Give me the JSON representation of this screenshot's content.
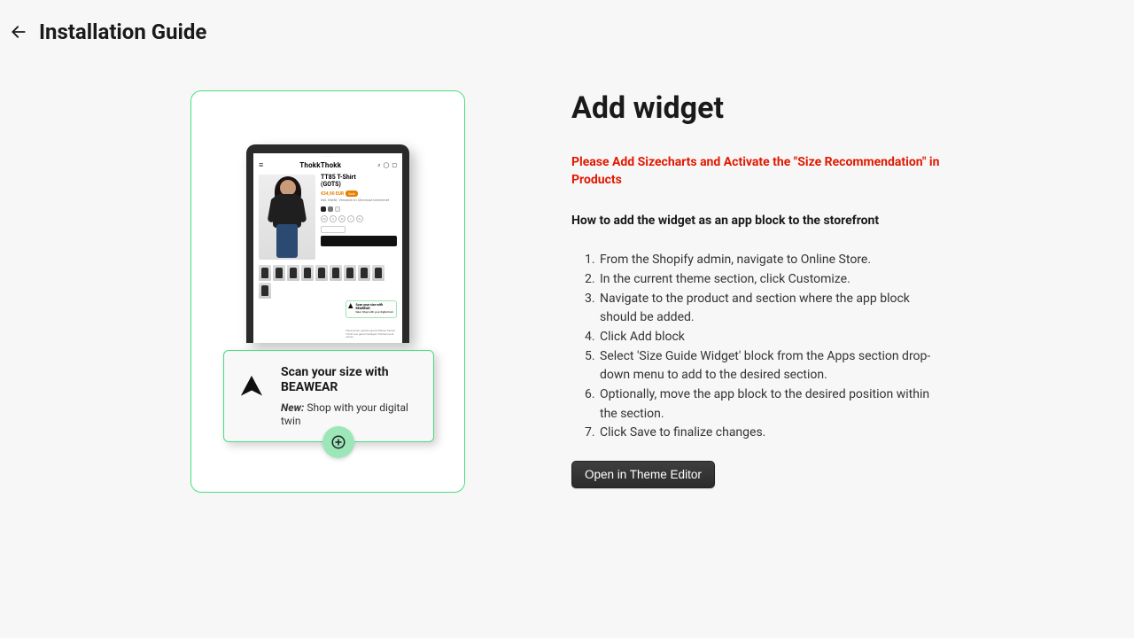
{
  "header": {
    "title": "Installation Guide"
  },
  "illustration": {
    "tablet": {
      "brand": "ThokkThokk",
      "product_title_l1": "TT85 T-Shirt",
      "product_title_l2": "(GOTS)",
      "price_old": "€34,90 EUR",
      "sale_badge": "Sale",
      "scan_mini_title": "Scan your size with BEAWEAR",
      "scan_mini_sub": "New: Shop with your digital twin"
    },
    "scan_card": {
      "title_l1": "Scan your size with",
      "title_l2": "BEAWEAR",
      "sub_prefix": "New:",
      "sub_rest": " Shop with your digital twin"
    }
  },
  "right": {
    "heading": "Add widget",
    "warning": "Please Add Sizecharts and Activate the \"Size Recommendation\" in Products",
    "subheading": "How to add the widget as an app block to the storefront",
    "steps": [
      "From the Shopify admin, navigate to Online Store.",
      "In the current theme section, click Customize.",
      "Navigate to the product and section where the app block should be added.",
      "Click Add block",
      "Select 'Size Guide Widget' block from the Apps section drop-down menu to add to the desired section.",
      "Optionally, move the app block to the desired position within the section.",
      "Click Save to finalize changes."
    ],
    "button": "Open in Theme Editor"
  }
}
